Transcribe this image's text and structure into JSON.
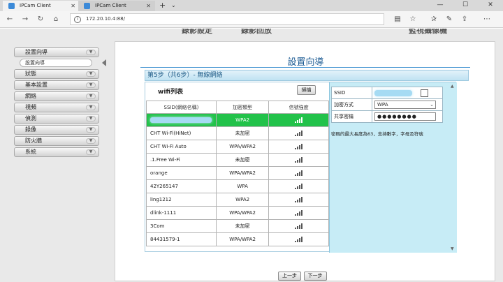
{
  "browser": {
    "tabs": [
      {
        "title": "IPCam Client"
      },
      {
        "title": "IPCam Client"
      }
    ],
    "url": "172.20.10.4:88/"
  },
  "header_ghost": [
    "錄影設定",
    "錄影回放",
    "監視攝像機"
  ],
  "menu": {
    "items": [
      {
        "label": "設置向導",
        "sub": "設置向導"
      },
      {
        "label": "狀態"
      },
      {
        "label": "基本設置"
      },
      {
        "label": "網絡"
      },
      {
        "label": "視頻"
      },
      {
        "label": "偵測"
      },
      {
        "label": "錄像"
      },
      {
        "label": "防火牆"
      },
      {
        "label": "系統"
      }
    ]
  },
  "page": {
    "title": "設置向導",
    "step_header": "第5步（共6步）- 無線網絡"
  },
  "wifi": {
    "title": "wifi列表",
    "scan_label": "掃描",
    "columns": [
      "SSID(網絡名稱)",
      "加密類型",
      "信號強度"
    ],
    "rows": [
      {
        "ssid": "",
        "encryption": "WPA2",
        "signal": 4,
        "selected": true
      },
      {
        "ssid": "CHT Wi-Fi(HiNet)",
        "encryption": "未加密",
        "signal": 4
      },
      {
        "ssid": "CHT Wi-Fi Auto",
        "encryption": "WPA/WPA2",
        "signal": 4
      },
      {
        "ssid": ".1.Free Wi-Fi",
        "encryption": "未加密",
        "signal": 4
      },
      {
        "ssid": "orange",
        "encryption": "WPA/WPA2",
        "signal": 4
      },
      {
        "ssid": "42Y265147",
        "encryption": "WPA",
        "signal": 4
      },
      {
        "ssid": "ling1212",
        "encryption": "WPA2",
        "signal": 4
      },
      {
        "ssid": "dlink-1111",
        "encryption": "WPA/WPA2",
        "signal": 4
      },
      {
        "ssid": "3Com",
        "encryption": "未加密",
        "signal": 4
      },
      {
        "ssid": "84431579-1",
        "encryption": "WPA/WPA2",
        "signal": 4
      }
    ]
  },
  "form": {
    "ssid_label": "SSID",
    "encryption_label": "加密方式",
    "encryption_value": "WPA",
    "key_label": "共享密鑰",
    "key_value": "●●●●●●●●",
    "note": "密碼的最大長度為63，支持數字，字母及符號"
  },
  "buttons": {
    "prev": "上一步",
    "next": "下一步"
  },
  "colors": {
    "selected_row": "#22c24a",
    "panel_bg": "#c7ecf6",
    "title_blue": "#1a5a92"
  }
}
